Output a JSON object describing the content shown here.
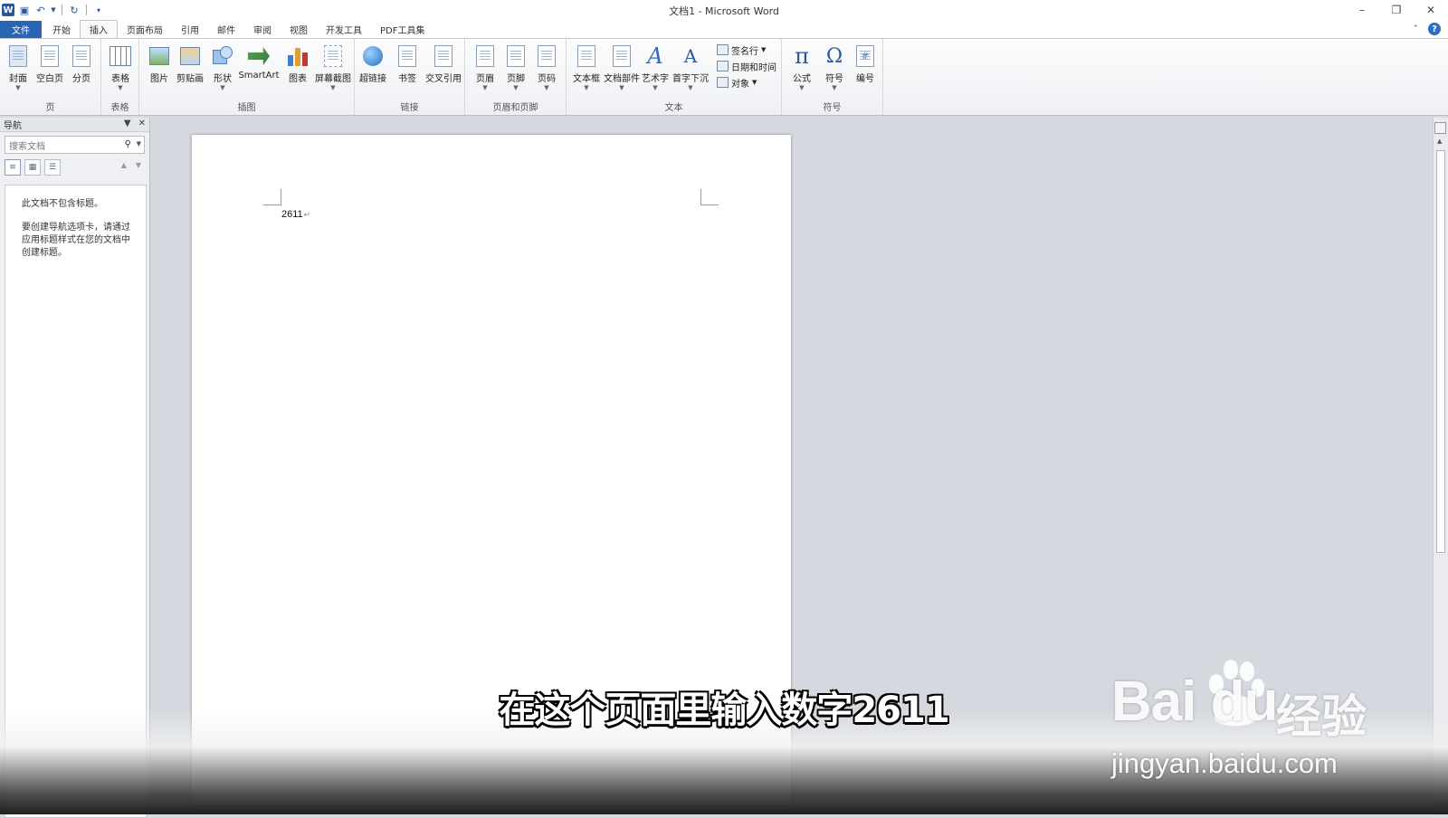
{
  "window": {
    "title": "文档1 - Microsoft Word"
  },
  "qat": {
    "app_icon": "W"
  },
  "tabs": [
    "文件",
    "开始",
    "插入",
    "页面布局",
    "引用",
    "邮件",
    "审阅",
    "视图",
    "开发工具",
    "PDF工具集"
  ],
  "active_tab": "插入",
  "ribbon": {
    "page": {
      "label": "页",
      "buttons": [
        "封面",
        "空白页",
        "分页"
      ]
    },
    "table": {
      "label": "表格",
      "buttons": [
        "表格"
      ]
    },
    "illustrations": {
      "label": "插图",
      "buttons": [
        "图片",
        "剪贴画",
        "形状",
        "SmartArt",
        "图表",
        "屏幕截图"
      ]
    },
    "links": {
      "label": "链接",
      "buttons": [
        "超链接",
        "书签",
        "交叉引用"
      ]
    },
    "header_footer": {
      "label": "页眉和页脚",
      "buttons": [
        "页眉",
        "页脚",
        "页码"
      ]
    },
    "text": {
      "label": "文本",
      "buttons": [
        "文本框",
        "文档部件",
        "艺术字",
        "首字下沉"
      ],
      "small": [
        "签名行",
        "日期和时间",
        "对象"
      ]
    },
    "symbols": {
      "label": "符号",
      "buttons": [
        "公式",
        "符号",
        "编号"
      ],
      "glyphs": [
        "π",
        "Ω",
        "#"
      ]
    }
  },
  "nav": {
    "title": "导航",
    "search_placeholder": "搜索文档",
    "msg1": "此文档不包含标题。",
    "msg2": "要创建导航选项卡，请通过应用标题样式在您的文档中创建标题。"
  },
  "document": {
    "text": "2611",
    "para_mark": "↵"
  },
  "overlay": {
    "caption": "在这个页面里输入数字2611",
    "watermark_logo": "Bai  du",
    "watermark_cn": "经验",
    "watermark_url": "jingyan.baidu.com"
  },
  "colors": {
    "file_tab": "#2a64b4",
    "word_blue": "#2b579a"
  }
}
